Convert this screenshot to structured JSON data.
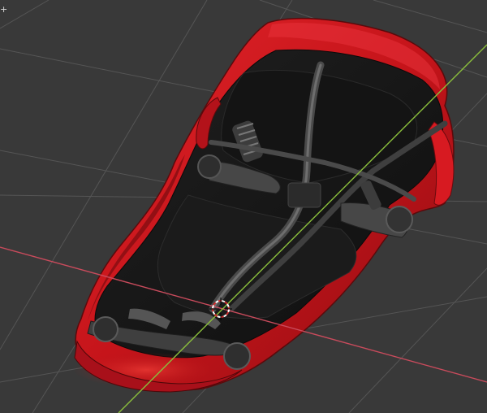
{
  "viewport": {
    "background_color": "#393939",
    "grid_color": "#555555",
    "x_axis_color": "#c94b5c",
    "y_axis_color": "#8bbf3c",
    "corner_glyph": "+"
  },
  "model": {
    "body_color": "#c5141a",
    "body_highlight_color": "#e4262b",
    "underside_color": "#161616",
    "chassis_color": "#262626",
    "parts_color": "#5a5a5a"
  },
  "cursor": {
    "icon": "3d-cursor-icon",
    "ring_color_a": "#ffffff",
    "ring_color_b": "#d12b2b"
  }
}
